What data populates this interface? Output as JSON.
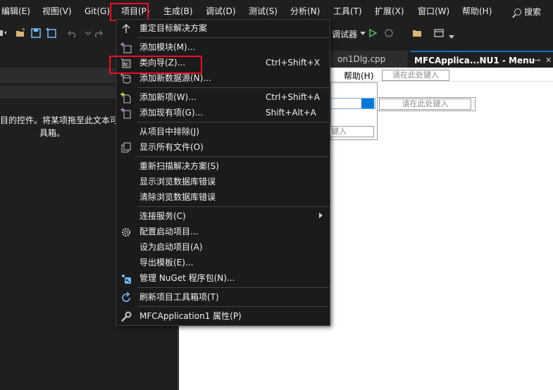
{
  "menubar": {
    "items": [
      "编辑(E)",
      "视图(V)",
      "Git(G)",
      "项目(P)",
      "生成(B)",
      "调试(D)",
      "测试(S)",
      "分析(N)",
      "工具(T)",
      "扩展(X)",
      "窗口(W)",
      "帮助(H)"
    ],
    "search_label": "搜索"
  },
  "toolbar": {
    "debugger_label": "调试器"
  },
  "tabs": {
    "inactive_label": "on1Dlg.cpp",
    "active_label": "MFCApplica...NU1 - Menu",
    "pin": "⊸",
    "close": "✕"
  },
  "left_panel": {
    "text_line1": "目的控件。将某项拖至此文本可在",
    "text_line2": "具箱。"
  },
  "designer": {
    "help_label": "帮助(H)",
    "type_here": "请在此处键入",
    "type_here_partial": "键入"
  },
  "project_menu": {
    "items": [
      {
        "label": "重定目标解决方案",
        "shortcut": "",
        "icon": "arrow-up-icon"
      },
      {
        "label": "添加模块(M)...",
        "shortcut": "",
        "icon": "add-module-icon"
      },
      {
        "label": "类向导(Z)...",
        "shortcut": "Ctrl+Shift+X",
        "icon": "class-wizard-icon"
      },
      {
        "label": "添加新数据源(N)...",
        "shortcut": "",
        "icon": "add-data-source-icon"
      },
      {
        "label": "添加新项(W)...",
        "shortcut": "Ctrl+Shift+A",
        "icon": "add-new-item-icon"
      },
      {
        "label": "添加现有项(G)...",
        "shortcut": "Shift+Alt+A",
        "icon": "add-existing-item-icon"
      },
      {
        "label": "从项目中排除(J)",
        "shortcut": "",
        "icon": ""
      },
      {
        "label": "显示所有文件(O)",
        "shortcut": "",
        "icon": "show-all-files-icon"
      },
      {
        "label": "重新扫描解决方案(S)",
        "shortcut": "",
        "icon": ""
      },
      {
        "label": "显示浏览数据库错误",
        "shortcut": "",
        "icon": ""
      },
      {
        "label": "清除浏览数据库错误",
        "shortcut": "",
        "icon": ""
      },
      {
        "label": "连接服务(C)",
        "shortcut": "",
        "icon": ""
      },
      {
        "label": "配置启动项目...",
        "shortcut": "",
        "icon": "gear-icon"
      },
      {
        "label": "设为启动项目(A)",
        "shortcut": "",
        "icon": ""
      },
      {
        "label": "导出模板(E)...",
        "shortcut": "",
        "icon": ""
      },
      {
        "label": "管理 NuGet 程序包(N)...",
        "shortcut": "",
        "icon": "nuget-icon"
      },
      {
        "label": "刷新项目工具箱项(T)",
        "shortcut": "",
        "icon": "refresh-icon"
      },
      {
        "label": "MFCApplication1 属性(P)",
        "shortcut": "",
        "icon": "wrench-icon"
      }
    ]
  },
  "colors": {
    "accent": "#0078d7",
    "highlight_box": "#e81123",
    "menu_bg": "#1b1b1c",
    "app_bg": "#1f1f1f"
  }
}
